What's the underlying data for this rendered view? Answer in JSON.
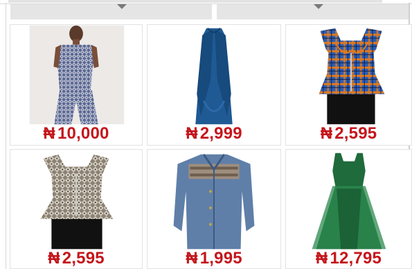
{
  "currency_symbol": "₦",
  "products": [
    {
      "price": "10,000",
      "image": "blue-geometric-print-jumpsuit"
    },
    {
      "price": "2,999",
      "image": "blue-waterfall-vest"
    },
    {
      "price": "2,595",
      "image": "plaid-ankara-peplum-top"
    },
    {
      "price": "2,595",
      "image": "print-peplum-bustier-top"
    },
    {
      "price": "1,995",
      "image": "denim-jacket"
    },
    {
      "price": "12,795",
      "image": "green-mesh-dress"
    }
  ],
  "colors": {
    "price": "#c4161c",
    "tab_bar": "#e5e5e5",
    "card_border": "#e2e2e2"
  }
}
